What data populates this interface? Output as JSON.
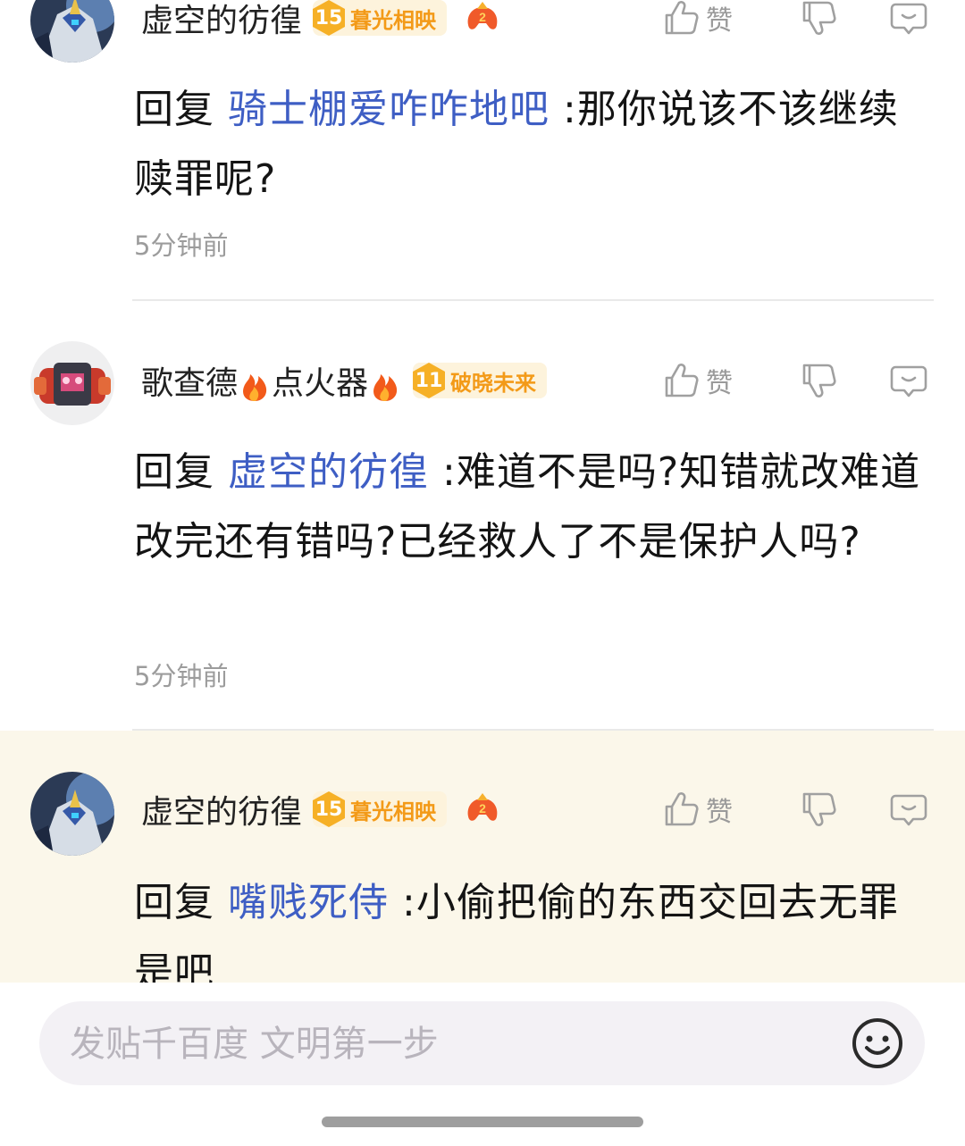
{
  "comments": [
    {
      "username": "虚空的彷徨",
      "level": "15",
      "level_title": "暮光相映",
      "like_label": "赞",
      "reply_prefix": "回复",
      "mention": "骑士棚爱咋咋地吧",
      "text": ":那你说该不该继续赎罪呢?",
      "time": "5分钟前",
      "avatar_icon": "anime-mecha-avatar",
      "badge_icon": "gamepad-icon"
    },
    {
      "username_part1": "歌查德",
      "username_part2": "点火器",
      "level": "11",
      "level_title": "破晓未来",
      "like_label": "赞",
      "reply_prefix": "回复",
      "mention": "虚空的彷徨",
      "text": ":难道不是吗?知错就改难道改完还有错吗?已经救人了不是保护人吗?",
      "time": "5分钟前",
      "avatar_icon": "robot-avatar"
    },
    {
      "username": "虚空的彷徨",
      "level": "15",
      "level_title": "暮光相映",
      "like_label": "赞",
      "reply_prefix": "回复",
      "mention": "嘴贱死侍",
      "text": ":小偷把偷的东西交回去无罪是吧",
      "avatar_icon": "anime-mecha-avatar",
      "badge_icon": "gamepad-icon"
    }
  ],
  "composer": {
    "placeholder": "发贴千百度 文明第一步",
    "emoji_icon": "smiley-icon"
  },
  "colors": {
    "mention": "#3e5ec4",
    "level_badge": "#f6b026",
    "highlight_bg": "#fbf7ea"
  }
}
